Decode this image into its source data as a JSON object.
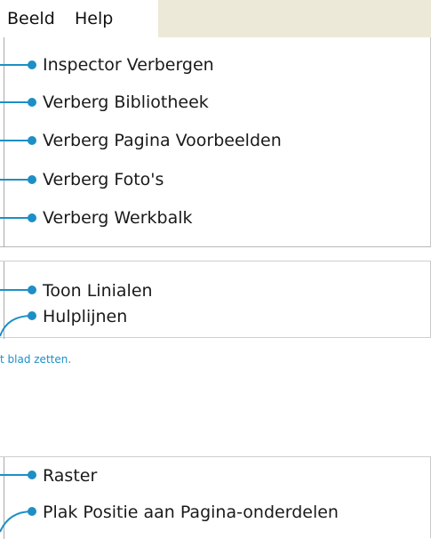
{
  "menubar": {
    "beeld_label": "Beeld",
    "help_label": "Help"
  },
  "menu_section_1": {
    "items": [
      {
        "label": "Inspector Verbergen"
      },
      {
        "label": "Verberg Bibliotheek"
      },
      {
        "label": "Verberg Pagina Voorbeelden"
      },
      {
        "label": "Verberg Foto's"
      },
      {
        "label": "Verberg Werkbalk"
      }
    ]
  },
  "menu_section_2": {
    "items": [
      {
        "label": "Toon Linialen"
      },
      {
        "label": "Hulplijnen"
      }
    ]
  },
  "caption": "t blad zetten.",
  "menu_section_3": {
    "items": [
      {
        "label": "Raster"
      },
      {
        "label": "Plak Positie aan Pagina-onderdelen"
      }
    ]
  },
  "colors": {
    "leader_line": "#1d8fc6",
    "menubar_bg": "#ece9d8",
    "caption": "#1d8fc6"
  }
}
